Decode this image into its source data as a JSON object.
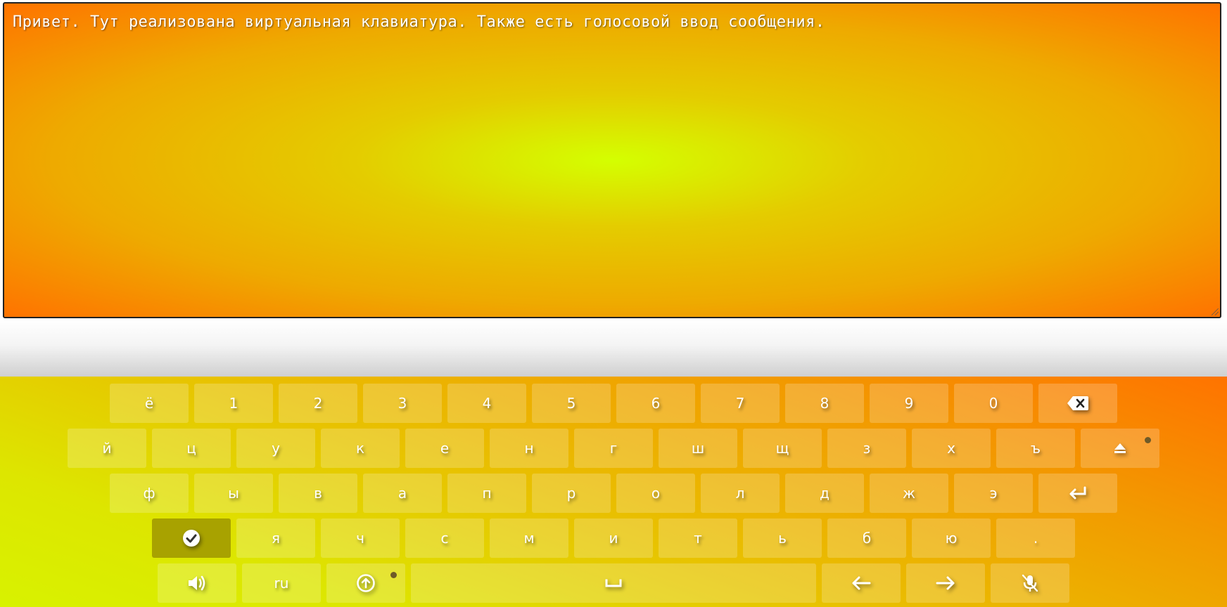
{
  "editor": {
    "text": "Привет. Тут реализована виртуальная клавиатура. Также есть голосовой ввод сообщения."
  },
  "keyboard": {
    "layout_label": "ru",
    "row1": [
      "ё",
      "1",
      "2",
      "3",
      "4",
      "5",
      "6",
      "7",
      "8",
      "9",
      "0"
    ],
    "row2": [
      "й",
      "ц",
      "у",
      "к",
      "е",
      "н",
      "г",
      "ш",
      "щ",
      "з",
      "х",
      "ъ"
    ],
    "row3": [
      "ф",
      "ы",
      "в",
      "а",
      "п",
      "р",
      "о",
      "л",
      "д",
      "ж",
      "э"
    ],
    "row4": [
      "я",
      "ч",
      "с",
      "м",
      "и",
      "т",
      "ь",
      "б",
      "ю",
      "."
    ],
    "icons": {
      "backspace": "backspace-icon",
      "eject": "eject-icon",
      "enter": "enter-icon",
      "confirm": "check-circle-icon",
      "sound": "speaker-icon",
      "shift": "shift-circle-icon",
      "space": "space-icon",
      "left": "arrow-left-icon",
      "right": "arrow-right-icon",
      "mic": "mic-off-icon"
    }
  },
  "colors": {
    "editor_center": "#d4ff00",
    "editor_edge": "#ff7300",
    "active_key": "#a8a200"
  }
}
